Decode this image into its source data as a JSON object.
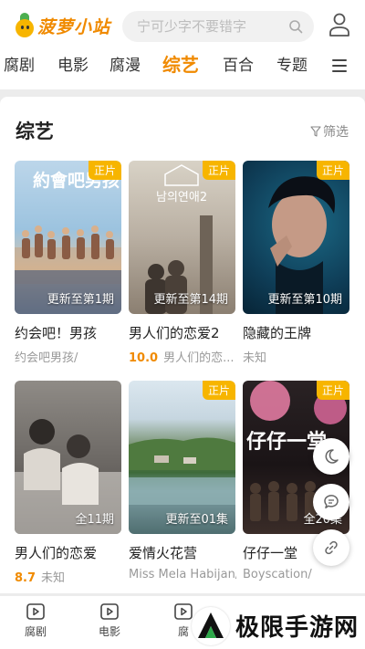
{
  "app": {
    "logo_text": "菠萝小站"
  },
  "search": {
    "placeholder": "宁可少字不要错字"
  },
  "nav": {
    "items": [
      {
        "label": "腐剧"
      },
      {
        "label": "电影"
      },
      {
        "label": "腐漫"
      },
      {
        "label": "综艺",
        "active": true
      },
      {
        "label": "百合"
      },
      {
        "label": "专题"
      }
    ]
  },
  "section": {
    "title": "综艺",
    "filter_label": "筛选"
  },
  "cards": [
    {
      "title": "约会吧！男孩",
      "badge": "正片",
      "update": "更新至第1期",
      "score": "",
      "subtitle": "约会吧男孩/"
    },
    {
      "title": "男人们的恋爱2",
      "badge": "正片",
      "update": "更新至第14期",
      "score": "10.0",
      "subtitle": "男人们的恋..."
    },
    {
      "title": "隐藏的王牌",
      "badge": "正片",
      "update": "更新至第10期",
      "score": "",
      "subtitle": "未知"
    },
    {
      "title": "男人们的恋爱",
      "badge": "",
      "update": "全11期",
      "score": "8.7",
      "subtitle": "未知"
    },
    {
      "title": "爱情火花营",
      "badge": "正片",
      "update": "更新至01集",
      "score": "",
      "subtitle": "Miss Mela Habijan/"
    },
    {
      "title": "仔仔一堂",
      "badge": "正片",
      "update": "全20集",
      "score": "",
      "subtitle": "Boyscation/"
    }
  ],
  "posters": {
    "p1_overlay": "約會吧男孩",
    "p2_overlay": "남의연애2",
    "p6_overlay": "仔仔一堂"
  },
  "tabbar": {
    "items": [
      {
        "label": "腐剧",
        "icon": "play-icon"
      },
      {
        "label": "电影",
        "icon": "play-icon"
      },
      {
        "label": "腐",
        "icon": "play-icon"
      }
    ]
  },
  "watermark": {
    "text": "极限手游网"
  },
  "colors": {
    "accent": "#f08a00",
    "badge": "#f7b500"
  }
}
